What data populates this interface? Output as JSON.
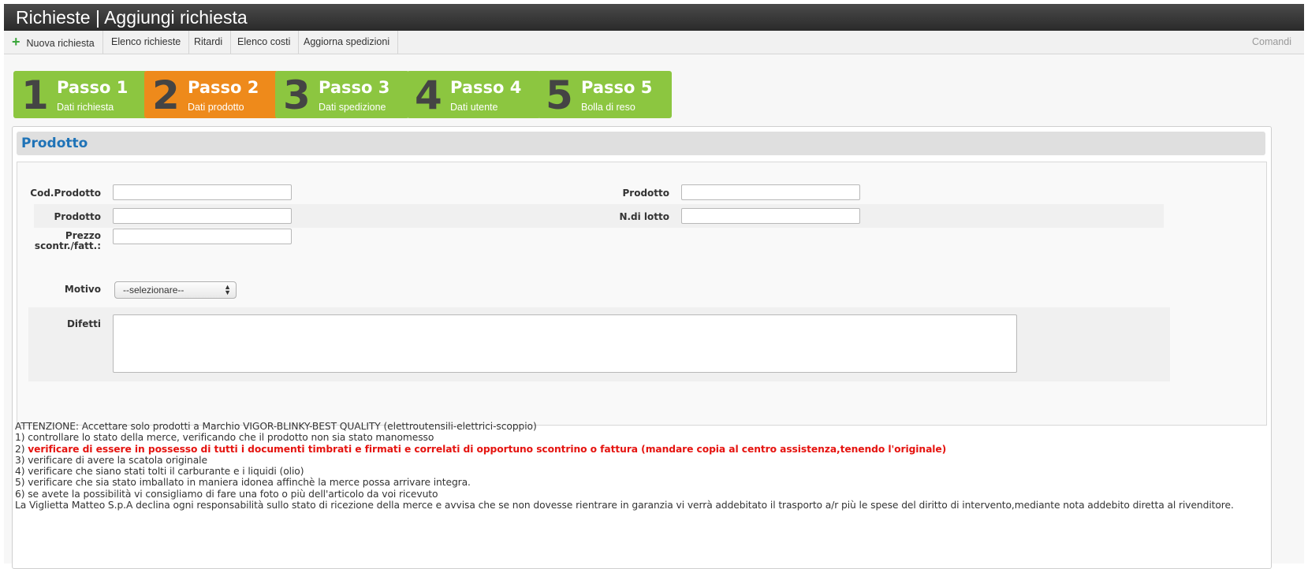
{
  "window": {
    "title": "Richieste | Aggiungi richiesta"
  },
  "toolbar": {
    "items": [
      {
        "label": "Nuova richiesta",
        "icon": "plus-icon"
      },
      {
        "label": "Elenco richieste"
      },
      {
        "label": "Ritardi"
      },
      {
        "label": "Elenco costi"
      },
      {
        "label": "Aggiorna spedizioni"
      }
    ],
    "right_label": "Comandi"
  },
  "steps": [
    {
      "num": "1",
      "title": "Passo 1",
      "subtitle": "Dati richiesta",
      "state": "done"
    },
    {
      "num": "2",
      "title": "Passo 2",
      "subtitle": "Dati prodotto",
      "state": "active"
    },
    {
      "num": "3",
      "title": "Passo 3",
      "subtitle": "Dati spedizione",
      "state": "todo"
    },
    {
      "num": "4",
      "title": "Passo 4",
      "subtitle": "Dati utente",
      "state": "todo"
    },
    {
      "num": "5",
      "title": "Passo 5",
      "subtitle": "Bolla di reso",
      "state": "todo"
    }
  ],
  "colors": {
    "step_green": "#8cc640",
    "step_orange": "#ee8a1b",
    "section_title": "#1f73b7",
    "warning_red": "#e5130f"
  },
  "section": {
    "title": "Prodotto"
  },
  "form": {
    "cod_prodotto": {
      "label": "Cod.Prodotto",
      "value": ""
    },
    "prodotto_right": {
      "label": "Prodotto",
      "value": ""
    },
    "prodotto_left": {
      "label": "Prodotto",
      "value": ""
    },
    "lotto": {
      "label": "N.di lotto",
      "value": ""
    },
    "prezzo": {
      "label_line1": "Prezzo",
      "label_line2": "scontr./fatt.:",
      "value": ""
    },
    "motivo": {
      "label": "Motivo",
      "selected": "--selezionare--"
    },
    "difetti": {
      "label": "Difetti",
      "value": ""
    }
  },
  "notes": {
    "attenzione": "ATTENZIONE: Accettare solo prodotti a Marchio VIGOR-BLINKY-BEST QUALITY (elettroutensili-elettrici-scoppio)",
    "n1": "1) controllare lo stato della merce, verificando che il prodotto non sia stato manomesso",
    "n2_prefix": "2) ",
    "n2_red": "verificare di essere in possesso di tutti i documenti timbrati e firmati e correlati di opportuno scontrino o fattura (mandare copia al centro assistenza,tenendo l'originale)",
    "n3": "3) verificare di avere la scatola originale",
    "n4": "4) verificare che siano stati tolti il carburante e i liquidi (olio)",
    "n5": "5) verificare che sia stato imballato in maniera idonea affinchè la merce possa arrivare integra.",
    "n6": "6) se avete la possibilità vi consigliamo di fare una foto o più dell'articolo da voi ricevuto",
    "disclaimer": "La Viglietta Matteo S.p.A declina ogni responsabilità sullo stato di ricezione della merce e avvisa che se non dovesse rientrare in garanzia vi verrà addebitato il trasporto a/r più le spese del diritto di intervento,mediante nota addebito diretta al rivenditore."
  }
}
